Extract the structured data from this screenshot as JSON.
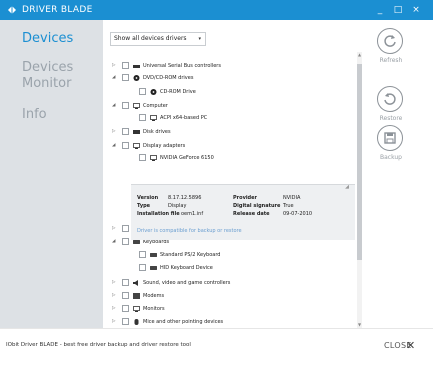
{
  "titlebar": {
    "title": "DRIVER BLADE",
    "minimize": "_",
    "maximize": "□",
    "close": "×"
  },
  "sidebar": {
    "items": [
      {
        "label": "Devices",
        "active": true
      },
      {
        "label": "Devices Monitor",
        "active": false
      },
      {
        "label": "Info",
        "active": false
      }
    ]
  },
  "filter": {
    "selected": "Show all devices drivers",
    "caret": "▾"
  },
  "tree": [
    {
      "label": "Universal Serial Bus controllers",
      "expander": "▷",
      "icon": "usb-icon"
    },
    {
      "label": "DVD/CD-ROM drives",
      "expander": "◢",
      "icon": "disc-icon"
    },
    {
      "label": "CD-ROM Drive",
      "expander": "",
      "icon": "disc-icon"
    },
    {
      "label": "Computer",
      "expander": "◢",
      "icon": "computer-icon"
    },
    {
      "label": "ACPI x64-based PC",
      "expander": "",
      "icon": "computer-icon"
    },
    {
      "label": "Disk drives",
      "expander": "▷",
      "icon": "disk-icon"
    },
    {
      "label": "Display adapters",
      "expander": "◢",
      "icon": "monitor-icon"
    },
    {
      "label": "NVIDIA GeForce 6150",
      "expander": "",
      "icon": "monitor-icon"
    },
    {
      "label": "IDE ATA/ATAPI controllers",
      "expander": "▷",
      "icon": "ide-icon"
    },
    {
      "label": "Keyboards",
      "expander": "◢",
      "icon": "keyboard-icon"
    },
    {
      "label": "Standard PS/2 Keyboard",
      "expander": "",
      "icon": "keyboard-icon"
    },
    {
      "label": "HID Keyboard Device",
      "expander": "",
      "icon": "keyboard-icon"
    },
    {
      "label": "Sound, video and game controllers",
      "expander": "▷",
      "icon": "speaker-icon"
    },
    {
      "label": "Modems",
      "expander": "▷",
      "icon": "modem-icon"
    },
    {
      "label": "Monitors",
      "expander": "▷",
      "icon": "monitor-icon"
    },
    {
      "label": "Mice and other pointing devices",
      "expander": "▷",
      "icon": "mouse-icon"
    }
  ],
  "details": {
    "version_label": "Version",
    "version": "8.17.12.5896",
    "type_label": "Type",
    "type": "Display",
    "install_label": "Installation file",
    "install": "oem1.inf",
    "provider_label": "Provider",
    "provider": "NVIDIA",
    "signature_label": "Digital signature",
    "signature": "True",
    "release_label": "Release date",
    "release": "09-07-2010",
    "note": "Driver is compatible for backup or restore"
  },
  "actions": {
    "refresh": "Refresh",
    "restore": "Restore",
    "backup": "Backup"
  },
  "footer": {
    "text": "IObit Driver BLADE - best free driver backup and driver restore tool",
    "close": "CLOSE",
    "close_x": "✕"
  },
  "colors": {
    "accent": "#1b8fd2",
    "sidebar_bg": "#dde1e5",
    "muted": "#9aa3ab"
  }
}
